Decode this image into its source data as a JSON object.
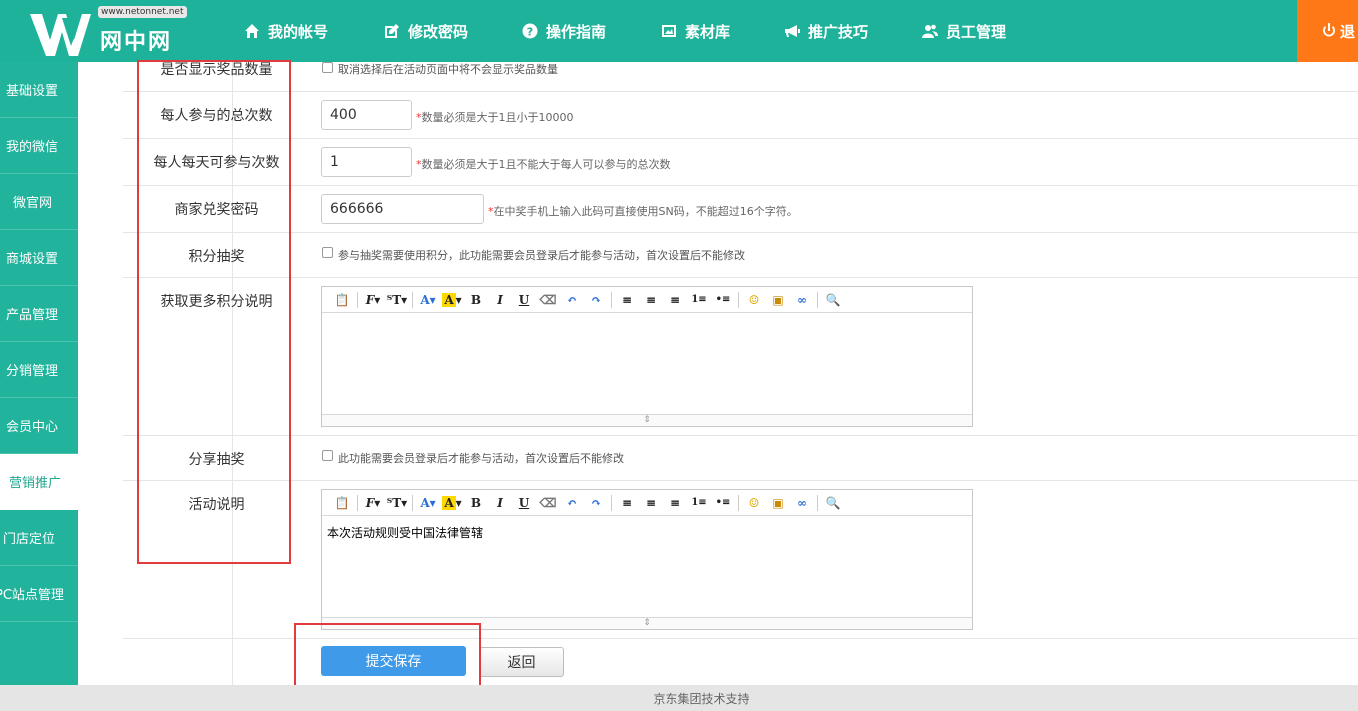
{
  "header": {
    "logo_site": "www.netonnet.net",
    "logo_name": "网中网",
    "nav": [
      {
        "label": "我的帐号",
        "icon": "home-icon"
      },
      {
        "label": "修改密码",
        "icon": "edit-icon"
      },
      {
        "label": "操作指南",
        "icon": "help-icon"
      },
      {
        "label": "素材库",
        "icon": "picture-icon"
      },
      {
        "label": "推广技巧",
        "icon": "bullhorn-icon"
      },
      {
        "label": "员工管理",
        "icon": "users-icon"
      }
    ],
    "logout_label": "退"
  },
  "sidebar": {
    "items": [
      {
        "label": "基础设置"
      },
      {
        "label": "我的微信"
      },
      {
        "label": "微官网"
      },
      {
        "label": "商城设置"
      },
      {
        "label": "产品管理"
      },
      {
        "label": "分销管理"
      },
      {
        "label": "会员中心"
      },
      {
        "label": "营销推广",
        "active": true
      },
      {
        "label": "门店定位"
      },
      {
        "label": "PC站点管理"
      }
    ]
  },
  "form": {
    "show_prize_count": {
      "label": "是否显示奖品数量",
      "checked": false,
      "text": "取消选择后在活动页面中将不会显示奖品数量"
    },
    "total_times": {
      "label": "每人参与的总次数",
      "value": "400",
      "hint_star": "*",
      "hint": "数量必须是大于1且小于10000"
    },
    "daily_times": {
      "label": "每人每天可参与次数",
      "value": "1",
      "hint_star": "*",
      "hint": "数量必须是大于1且不能大于每人可以参与的总次数"
    },
    "merchant_password": {
      "label": "商家兑奖密码",
      "value": "666666",
      "hint_star": "*",
      "hint": "在中奖手机上输入此码可直接使用SN码，不能超过16个字符。"
    },
    "points_lottery": {
      "label": "积分抽奖",
      "checked": false,
      "text": "参与抽奖需要使用积分，此功能需要会员登录后才能参与活动，首次设置后不能修改"
    },
    "more_points_desc": {
      "label": "获取更多积分说明",
      "content": ""
    },
    "share_lottery": {
      "label": "分享抽奖",
      "checked": false,
      "text": "此功能需要会员登录后才能参与活动，首次设置后不能修改"
    },
    "activity_desc": {
      "label": "活动说明",
      "content": "本次活动规则受中国法律管辖"
    },
    "submit_label": "提交保存",
    "back_label": "返回"
  },
  "footer": {
    "text": "京东集团技术支持"
  },
  "colors": {
    "brand": "#1fb29a",
    "logout": "#ff7817",
    "primary_button": "#3f9bea",
    "highlight_box": "#e23b3b"
  }
}
